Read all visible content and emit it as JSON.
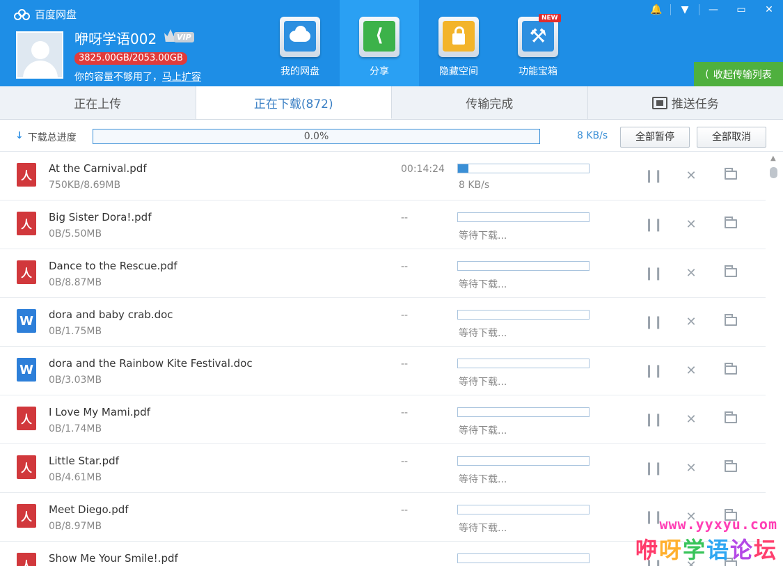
{
  "app": {
    "title": "百度网盘"
  },
  "user": {
    "name": "咿呀学语002",
    "vip_badge": "VIP",
    "quota": "3825.00GB/2053.00GB",
    "upsell_text": "你的容量不够用了，",
    "upsell_link": "马上扩容"
  },
  "nav": {
    "items": [
      {
        "label": "我的网盘",
        "icon": "cloud-drive-icon"
      },
      {
        "label": "分享",
        "icon": "share-icon"
      },
      {
        "label": "隐藏空间",
        "icon": "lock-icon"
      },
      {
        "label": "功能宝箱",
        "icon": "toolbox-icon",
        "badge": "NEW"
      }
    ]
  },
  "window_controls": [
    "bell-icon",
    "menu-icon",
    "minimize-icon",
    "maximize-icon",
    "close-icon"
  ],
  "collapse_button": "收起传输列表",
  "tabs": [
    "正在上传",
    "正在下载(872)",
    "传输完成",
    "推送任务"
  ],
  "summary": {
    "label": "下载总进度",
    "progress_text": "0.0%",
    "speed": "8 KB/s",
    "pause_all": "全部暂停",
    "cancel_all": "全部取消"
  },
  "files": [
    {
      "name": "At the Carnival.pdf",
      "size": "750KB/8.69MB",
      "type": "pdf",
      "eta": "00:14:24",
      "status": "8 KB/s",
      "progress": 0.08
    },
    {
      "name": "Big Sister Dora!.pdf",
      "size": "0B/5.50MB",
      "type": "pdf",
      "eta": "--",
      "status": "等待下载...",
      "progress": 0
    },
    {
      "name": "Dance to the Rescue.pdf",
      "size": "0B/8.87MB",
      "type": "pdf",
      "eta": "--",
      "status": "等待下载...",
      "progress": 0
    },
    {
      "name": "dora and baby crab.doc",
      "size": "0B/1.75MB",
      "type": "doc",
      "eta": "--",
      "status": "等待下载...",
      "progress": 0
    },
    {
      "name": "dora and the Rainbow Kite Festival.doc",
      "size": "0B/3.03MB",
      "type": "doc",
      "eta": "--",
      "status": "等待下载...",
      "progress": 0
    },
    {
      "name": "I Love My Mami.pdf",
      "size": "0B/1.74MB",
      "type": "pdf",
      "eta": "--",
      "status": "等待下载...",
      "progress": 0
    },
    {
      "name": "Little Star.pdf",
      "size": "0B/4.61MB",
      "type": "pdf",
      "eta": "--",
      "status": "等待下载...",
      "progress": 0
    },
    {
      "name": "Meet Diego.pdf",
      "size": "0B/8.97MB",
      "type": "pdf",
      "eta": "--",
      "status": "等待下载...",
      "progress": 0
    },
    {
      "name": "Show Me Your Smile!.pdf",
      "size": "",
      "type": "pdf",
      "eta": "",
      "status": "",
      "progress": 0
    }
  ],
  "watermark": {
    "url": "www.yyxyu.com",
    "text": [
      "咿",
      "呀",
      "学",
      "语",
      "论",
      "坛"
    ]
  },
  "colors": {
    "header": "#1e8ee6",
    "accent": "#3a8fd6",
    "collapse": "#4fb03e",
    "quota_badge": "#e13b3b"
  }
}
